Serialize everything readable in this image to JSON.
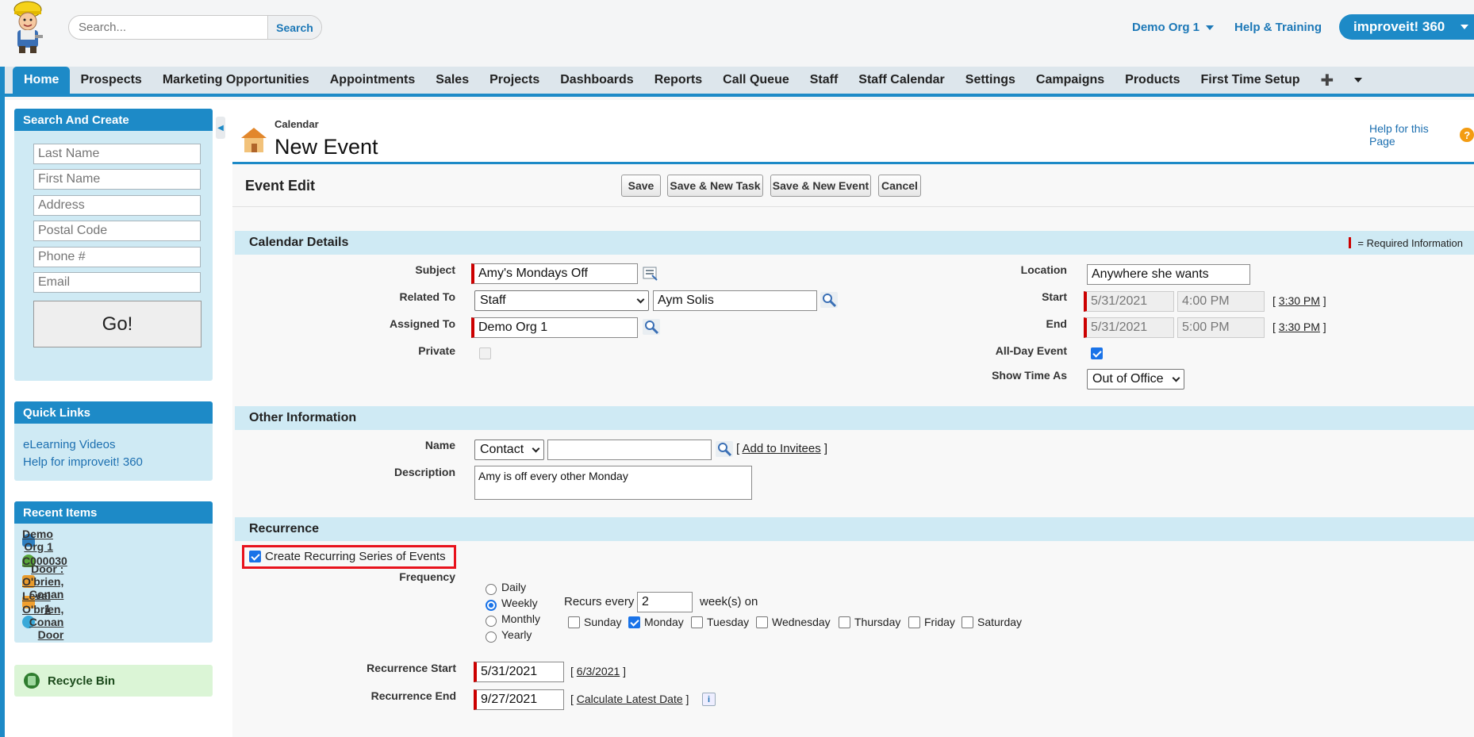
{
  "header": {
    "search_placeholder": "Search...",
    "search_button": "Search",
    "org_menu": "Demo Org 1",
    "help_training": "Help & Training",
    "app_name": "improveit! 360"
  },
  "tabs": [
    "Home",
    "Prospects",
    "Marketing Opportunities",
    "Appointments",
    "Sales",
    "Projects",
    "Dashboards",
    "Reports",
    "Call Queue",
    "Staff",
    "Staff Calendar",
    "Settings",
    "Campaigns",
    "Products",
    "First Time Setup"
  ],
  "sidebar": {
    "search_create": {
      "title": "Search And Create",
      "placeholders": [
        "Last Name",
        "First Name",
        "Address",
        "Postal Code",
        "Phone #",
        "Email"
      ],
      "go_label": "Go!"
    },
    "quick_links": {
      "title": "Quick Links",
      "links": [
        "eLearning Videos",
        "Help for improveit! 360"
      ]
    },
    "recent_items": {
      "title": "Recent Items",
      "items": [
        "Demo Org 1",
        "C000030",
        "Door : O'brien, Conan",
        "Level 1",
        "O'brien, Conan Door"
      ]
    },
    "recycle_bin": "Recycle Bin"
  },
  "page": {
    "subtitle": "Calendar",
    "title": "New Event",
    "help_link": "Help for this Page"
  },
  "edit": {
    "title": "Event Edit",
    "buttons": {
      "save": "Save",
      "save_new_task": "Save & New Task",
      "save_new_event": "Save & New Event",
      "cancel": "Cancel"
    }
  },
  "calendar_details": {
    "heading": "Calendar Details",
    "required_note": "= Required Information",
    "labels": {
      "subject": "Subject",
      "related_to": "Related To",
      "assigned_to": "Assigned To",
      "private": "Private",
      "location": "Location",
      "start": "Start",
      "end": "End",
      "all_day": "All-Day Event",
      "show_time_as": "Show Time As"
    },
    "values": {
      "subject": "Amy's Mondays Off",
      "related_type": "Staff",
      "related_name": "Aym Solis",
      "assigned_to": "Demo Org 1",
      "location": "Anywhere she wants",
      "start_date": "5/31/2021",
      "start_time": "4:00 PM",
      "start_link": "3:30 PM",
      "end_date": "5/31/2021",
      "end_time": "5:00 PM",
      "end_link": "3:30 PM",
      "show_time_as": "Out of Office",
      "private": false,
      "all_day": true
    }
  },
  "other_info": {
    "heading": "Other Information",
    "labels": {
      "name": "Name",
      "description": "Description"
    },
    "name_type": "Contact",
    "add_invitees": "Add to Invitees",
    "description": "Amy is off every other Monday"
  },
  "recurrence": {
    "heading": "Recurrence",
    "create_series_label": "Create Recurring Series of Events",
    "create_series_checked": true,
    "frequency_label": "Frequency",
    "frequencies": [
      "Daily",
      "Weekly",
      "Monthly",
      "Yearly"
    ],
    "selected_frequency": "Weekly",
    "recurs_every_label": "Recurs every",
    "recurs_every_value": "2",
    "weeks_on_label": "week(s) on",
    "days": [
      "Sunday",
      "Monday",
      "Tuesday",
      "Wednesday",
      "Thursday",
      "Friday",
      "Saturday"
    ],
    "selected_days": [
      "Monday"
    ],
    "start_label": "Recurrence Start",
    "start_value": "5/31/2021",
    "start_link": "6/3/2021",
    "end_label": "Recurrence End",
    "end_value": "9/27/2021",
    "calc_link": "Calculate Latest Date"
  }
}
